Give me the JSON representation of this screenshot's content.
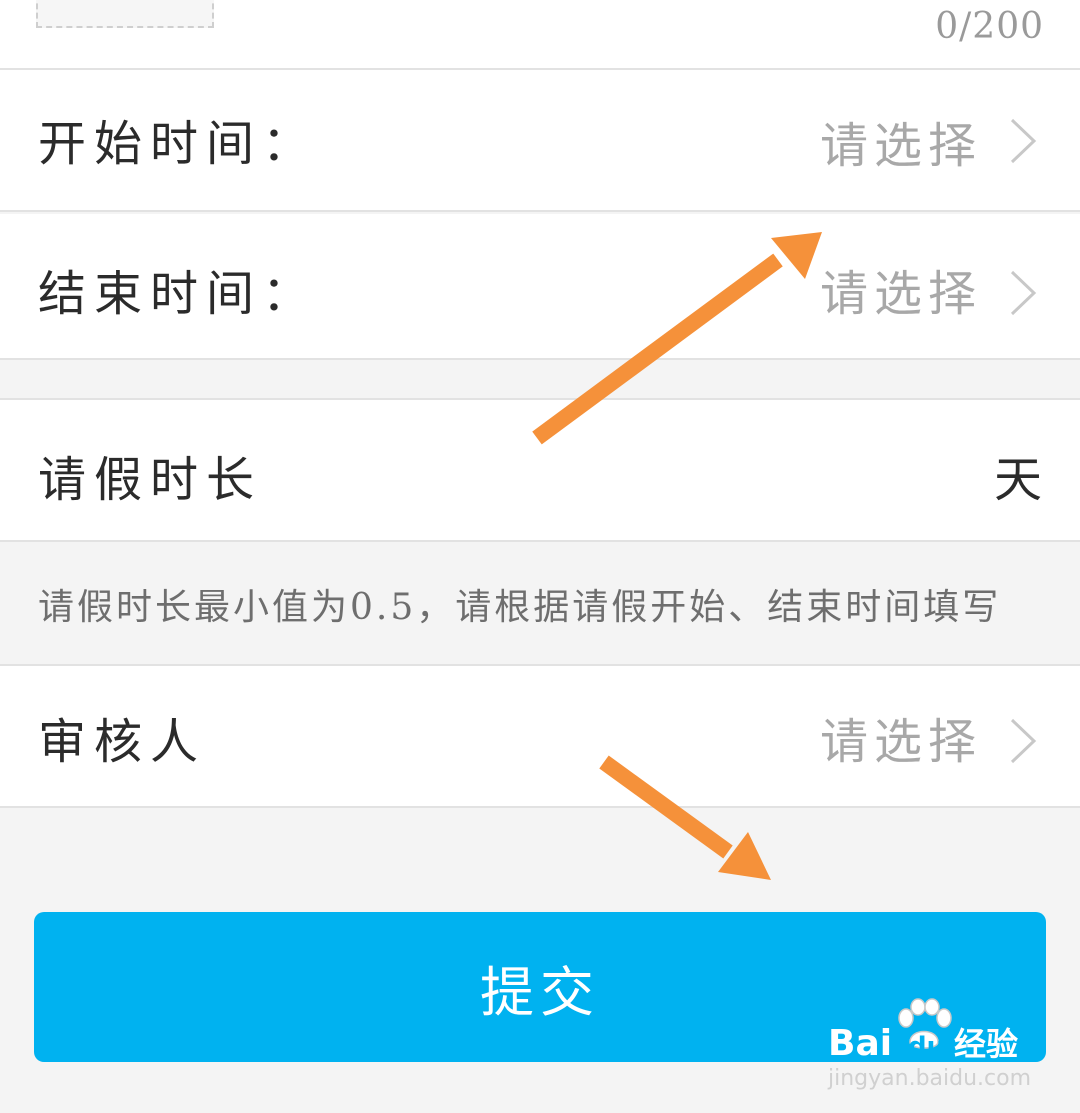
{
  "remark": {
    "char_counter": "0/200"
  },
  "form": {
    "start_time": {
      "label": "开始时间：",
      "placeholder": "请选择"
    },
    "end_time": {
      "label": "结束时间：",
      "placeholder": "请选择"
    },
    "duration": {
      "label": "请假时长",
      "unit": "天"
    },
    "duration_hint": "请假时长最小值为0.5，请根据请假开始、结束时间填写",
    "approver": {
      "label": "审核人",
      "placeholder": "请选择"
    }
  },
  "submit_label": "提交",
  "watermark": {
    "logo_text": "Bai",
    "logo_du": "du",
    "logo_suffix": "经验",
    "url": "jingyan.baidu.com"
  },
  "colors": {
    "accent": "#00b2f0",
    "annotation_arrow": "#f5913a",
    "label_text": "#2b2b2b",
    "placeholder_text": "#a8a8a8",
    "background": "#f4f4f4"
  },
  "icons": {
    "row_chevron": "chevron-right-icon",
    "annotation": "arrow-icon",
    "watermark_logo": "paw-icon"
  }
}
